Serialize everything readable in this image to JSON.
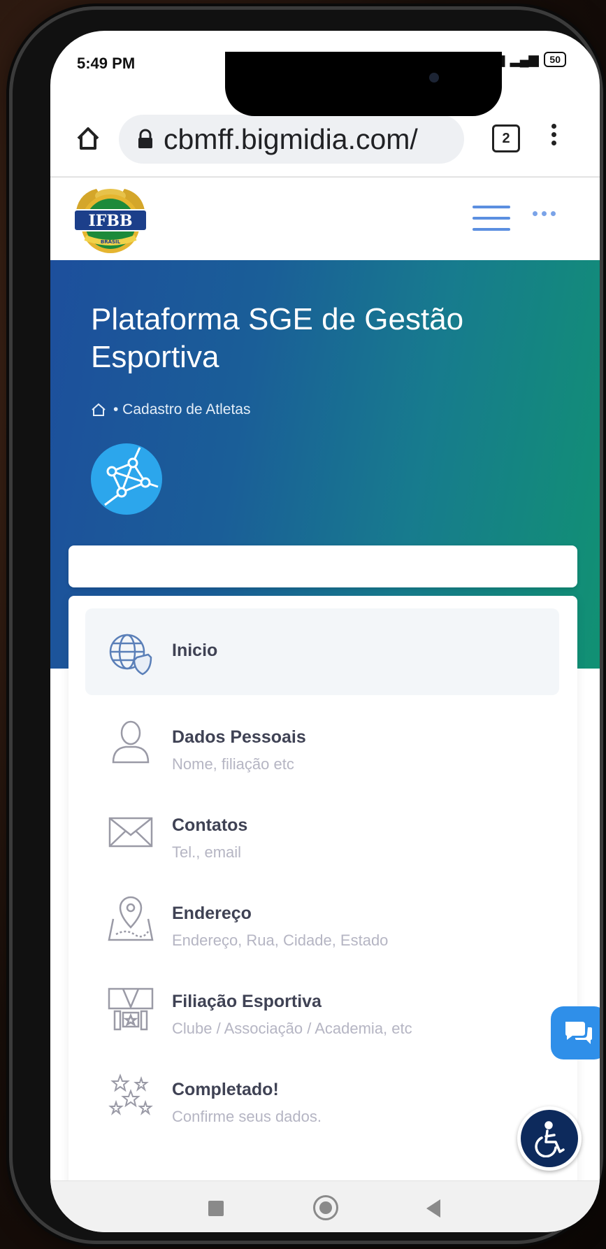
{
  "status": {
    "time": "5:49 PM",
    "battery": "50"
  },
  "browser": {
    "url": "cbmff.bigmidia.com/",
    "tab_count": "2"
  },
  "site": {
    "logo_text": "IFBB",
    "logo_subtext": "BRASIL"
  },
  "hero": {
    "title": "Plataforma SGE de Gestão Esportiva",
    "breadcrumb": "• Cadastro de Atletas"
  },
  "steps": [
    {
      "title": "Inicio",
      "subtitle": "",
      "icon": "globe-shield-icon",
      "active": true
    },
    {
      "title": "Dados Pessoais",
      "subtitle": "Nome, filiação etc",
      "icon": "user-icon"
    },
    {
      "title": "Contatos",
      "subtitle": "Tel., email",
      "icon": "envelope-icon"
    },
    {
      "title": "Endereço",
      "subtitle": "Endereço, Rua, Cidade, Estado",
      "icon": "map-pin-icon"
    },
    {
      "title": "Filiação Esportiva",
      "subtitle": "Clube / Associação / Academia, etc",
      "icon": "medal-icon"
    },
    {
      "title": "Completado!",
      "subtitle": "Confirme seus dados.",
      "icon": "stars-icon"
    }
  ],
  "colors": {
    "hero_start": "#1d4f9c",
    "hero_end": "#119173",
    "accent": "#2f8fe9",
    "text_title": "#3f4254",
    "text_muted": "#b5b5c3"
  }
}
